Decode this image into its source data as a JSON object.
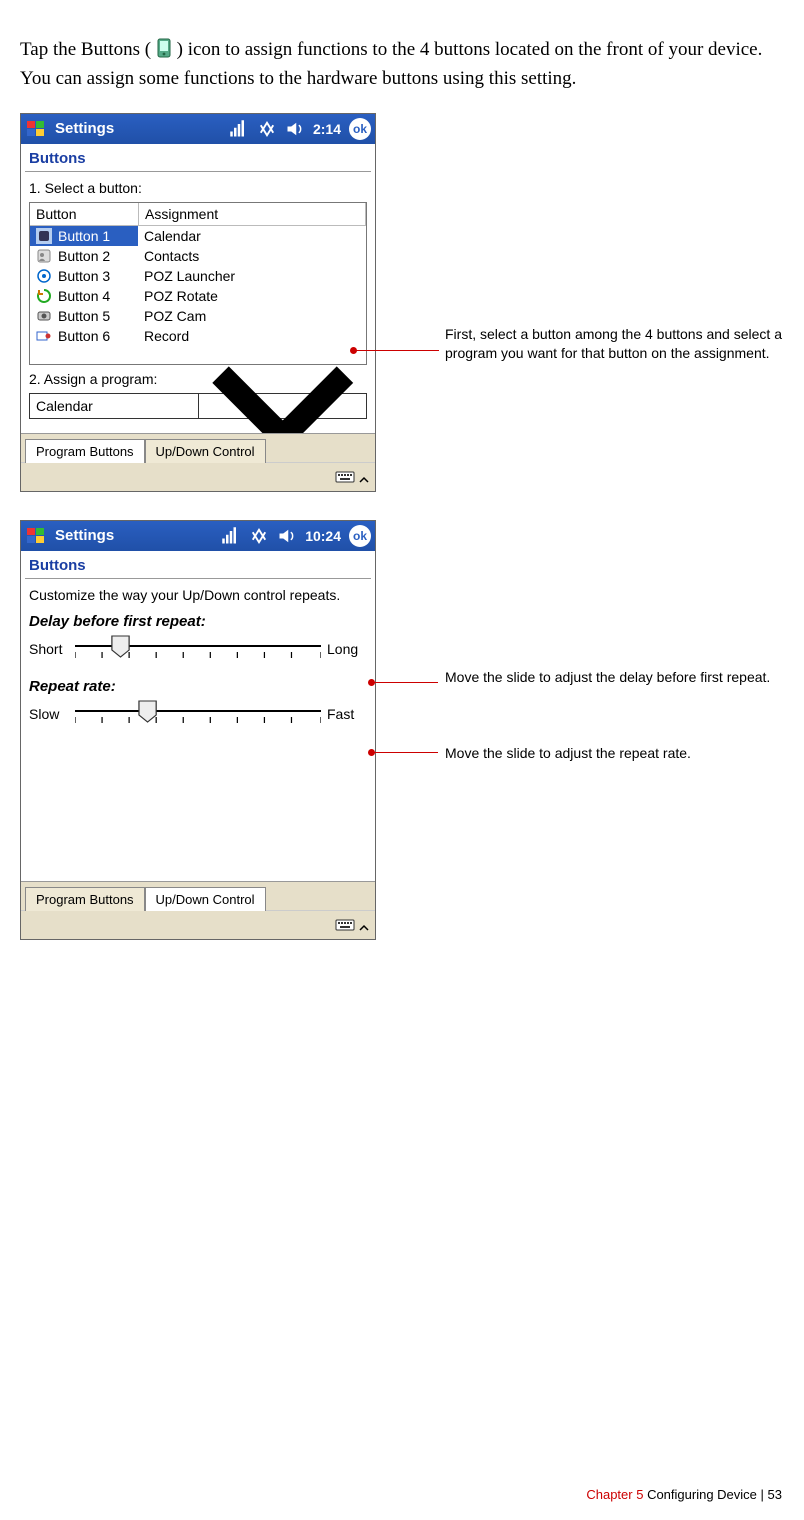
{
  "intro": {
    "part1": "Tap the Buttons (",
    "part2": ") icon to assign functions to the 4 buttons located on the front of your device. You can assign some functions to the hardware buttons using this setting."
  },
  "shot1": {
    "title": "Settings",
    "time": "2:14",
    "ok": "ok",
    "heading": "Buttons",
    "step1": "1. Select a button:",
    "col_button": "Button",
    "col_assign": "Assignment",
    "rows": [
      {
        "btn": "Button 1",
        "asg": "Calendar"
      },
      {
        "btn": "Button 2",
        "asg": "Contacts"
      },
      {
        "btn": "Button 3",
        "asg": "POZ Launcher"
      },
      {
        "btn": "Button 4",
        "asg": "POZ Rotate"
      },
      {
        "btn": "Button 5",
        "asg": "POZ Cam"
      },
      {
        "btn": "Button 6",
        "asg": "Record"
      }
    ],
    "step2": "2. Assign a program:",
    "combo": "Calendar",
    "tab1": "Program Buttons",
    "tab2": "Up/Down Control"
  },
  "shot2": {
    "title": "Settings",
    "time": "10:24",
    "ok": "ok",
    "heading": "Buttons",
    "desc": "Customize the way your Up/Down control repeats.",
    "h_delay": "Delay before first repeat:",
    "short": "Short",
    "long": "Long",
    "h_rate": "Repeat rate:",
    "slow": "Slow",
    "fast": "Fast",
    "tab1": "Program Buttons",
    "tab2": "Up/Down Control"
  },
  "annot": {
    "a1": "First, select a button among the 4 buttons and select a program you want for that button on the assignment.",
    "a2": "Move the slide to adjust the delay before first repeat.",
    "a3": "Move the slide to adjust the repeat rate."
  },
  "footer": {
    "chapter": "Chapter 5",
    "title": "Configuring Device",
    "sep": "   |  ",
    "page": "53"
  }
}
